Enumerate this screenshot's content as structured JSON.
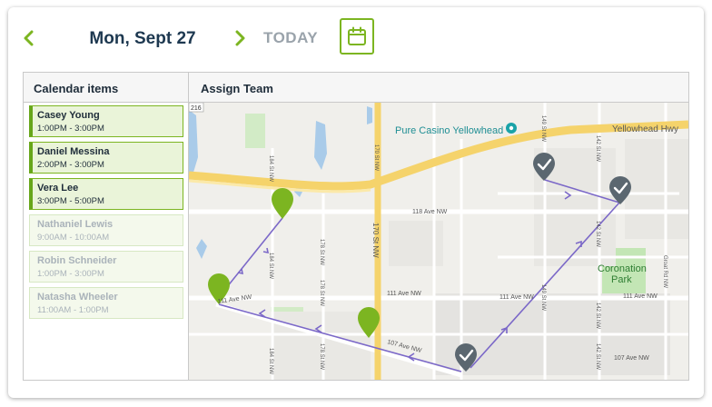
{
  "header": {
    "date": "Mon, Sept 27",
    "today_label": "TODAY",
    "prev_icon": "chevron-left-icon",
    "next_icon": "chevron-right-icon",
    "calendar_icon": "calendar-icon",
    "accent_color": "#7cb521"
  },
  "left_panel": {
    "title": "Calendar items",
    "items": [
      {
        "name": "Casey Young",
        "time": "1:00PM - 3:00PM",
        "assigned": true
      },
      {
        "name": "Daniel Messina",
        "time": "2:00PM - 3:00PM",
        "assigned": true
      },
      {
        "name": "Vera Lee",
        "time": "3:00PM - 5:00PM",
        "assigned": true
      },
      {
        "name": "Nathaniel Lewis",
        "time": "9:00AM - 10:00AM",
        "assigned": false
      },
      {
        "name": "Robin Schneider",
        "time": "1:00PM - 3:00PM",
        "assigned": false
      },
      {
        "name": "Natasha Wheeler",
        "time": "11:00AM - 1:00PM",
        "assigned": false
      }
    ]
  },
  "map_panel": {
    "title": "Assign Team",
    "labels": {
      "poi": "Pure Casino Yellowhead",
      "hwy": "Yellowhead Hwy",
      "park1": "Coronation",
      "park2": "Park",
      "ave118": "118 Ave NW",
      "ave111a": "111 Ave NW",
      "ave111b": "111 Ave NW",
      "ave111c": "111 Ave NW",
      "ave111d": "111 Ave NW",
      "ave107": "107 Ave NW",
      "ave107b": "107 Ave NW",
      "st170": "170 St NW",
      "st170b": "170 St NW",
      "st178a": "178 St NW",
      "st178b": "178 St NW",
      "st178c": "178 St NW",
      "st184a": "184 St NW",
      "st184b": "184 St NW",
      "st184c": "184 St NW",
      "st149a": "149 St NW",
      "st149b": "149 St NW",
      "st142a": "142 St NW",
      "st142b": "142 St NW",
      "st142c": "142 St NW",
      "st142d": "142 St NW",
      "groat": "Groat Rd NW",
      "route": "216"
    },
    "route_color": "#7b68c8",
    "green_pin_color": "#7cb521",
    "done_pin_color": "#5b6770"
  }
}
